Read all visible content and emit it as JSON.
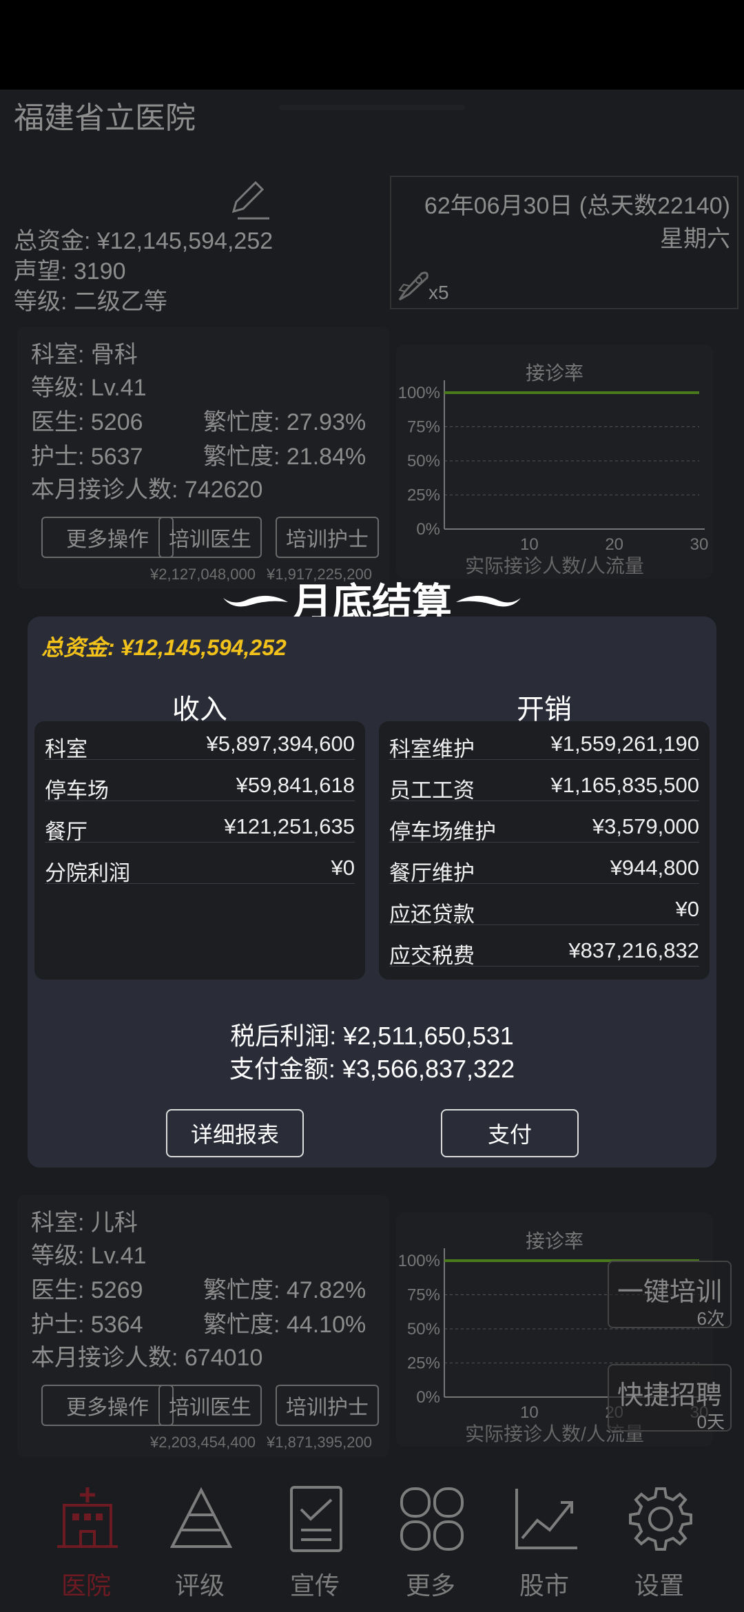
{
  "hospital": {
    "name": "福建省立医院",
    "funds_line": "总资金: ¥12,145,594,252",
    "reputation_line": "声望: 3190",
    "grade_line": "等级: 二级乙等"
  },
  "date": {
    "line1": "62年06月30日 (总天数22140)",
    "line2": "星期六",
    "speed": "x5"
  },
  "departments": [
    {
      "dept": "科室: 骨科",
      "level": "等级: Lv.41",
      "doctors": "医生: 5206",
      "doctor_busy": "繁忙度: 27.93%",
      "nurses": "护士: 5637",
      "nurse_busy": "繁忙度: 21.84%",
      "patients": "本月接诊人数: 742620",
      "btn_more": "更多操作",
      "btn_train_doctor": "培训医生",
      "btn_train_nurse": "培训护士",
      "cost_doctor": "¥2,127,048,000",
      "cost_nurse": "¥1,917,225,200"
    },
    {
      "dept": "科室: 儿科",
      "level": "等级: Lv.41",
      "doctors": "医生: 5269",
      "doctor_busy": "繁忙度: 47.82%",
      "nurses": "护士: 5364",
      "nurse_busy": "繁忙度: 44.10%",
      "patients": "本月接诊人数: 674010",
      "btn_more": "更多操作",
      "btn_train_doctor": "培训医生",
      "btn_train_nurse": "培训护士",
      "cost_doctor": "¥2,203,454,400",
      "cost_nurse": "¥1,871,395,200"
    }
  ],
  "chart_data": [
    {
      "type": "line",
      "title": "接诊率",
      "xlabel": "实际接诊人数/人流量",
      "ylabel": "",
      "x_ticks": [
        "10",
        "20",
        "30"
      ],
      "y_ticks": [
        "100%",
        "75%",
        "50%",
        "25%",
        "0%"
      ],
      "xlim": [
        0,
        30
      ],
      "ylim": [
        0,
        100
      ],
      "series": [
        {
          "values": [
            100,
            100
          ]
        }
      ],
      "grid": true
    },
    {
      "type": "line",
      "title": "接诊率",
      "xlabel": "实际接诊人数/人流量",
      "ylabel": "",
      "x_ticks": [
        "10",
        "20",
        "30"
      ],
      "y_ticks": [
        "100%",
        "75%",
        "50%",
        "25%",
        "0%"
      ],
      "xlim": [
        0,
        30
      ],
      "ylim": [
        0,
        100
      ],
      "series": [
        {
          "values": [
            100,
            100
          ]
        }
      ],
      "grid": true
    }
  ],
  "float_buttons": {
    "train_all": {
      "label": "一键培训",
      "sub": "6次"
    },
    "quick_hire": {
      "label": "快捷招聘",
      "sub": "0天"
    }
  },
  "nav": [
    {
      "label": "医院"
    },
    {
      "label": "评级"
    },
    {
      "label": "宣传"
    },
    {
      "label": "更多"
    },
    {
      "label": "股市"
    },
    {
      "label": "设置"
    }
  ],
  "modal": {
    "title": "月底结算",
    "funds": "总资金: ¥12,145,594,252",
    "income_header": "收入",
    "expense_header": "开销",
    "income": [
      {
        "k": "科室",
        "v": "¥5,897,394,600"
      },
      {
        "k": "停车场",
        "v": "¥59,841,618"
      },
      {
        "k": "餐厅",
        "v": "¥121,251,635"
      },
      {
        "k": "分院利润",
        "v": "¥0"
      }
    ],
    "expense": [
      {
        "k": "科室维护",
        "v": "¥1,559,261,190"
      },
      {
        "k": "员工工资",
        "v": "¥1,165,835,500"
      },
      {
        "k": "停车场维护",
        "v": "¥3,579,000"
      },
      {
        "k": "餐厅维护",
        "v": "¥944,800"
      },
      {
        "k": "应还贷款",
        "v": "¥0"
      },
      {
        "k": "应交税费",
        "v": "¥837,216,832"
      }
    ],
    "profit": "税后利润: ¥2,511,650,531",
    "payment": "支付金额: ¥3,566,837,322",
    "btn_report": "详细报表",
    "btn_pay": "支付"
  },
  "colors": {
    "accent_gold": "#f2c21b",
    "nav_active": "#6e1a23",
    "modal_bg": "#2a2d38",
    "series_green": "#4a7a1c"
  }
}
